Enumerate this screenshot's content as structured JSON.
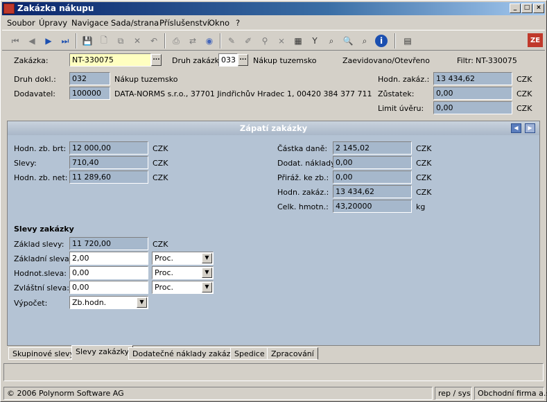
{
  "window": {
    "title": "Zakázka nákupu"
  },
  "menu": [
    {
      "label": "Soubor"
    },
    {
      "label": "Úpravy"
    },
    {
      "label": "Navigace"
    },
    {
      "label": "Sada/strana"
    },
    {
      "label": "Příslušenství"
    },
    {
      "label": "Okno"
    },
    {
      "label": "?"
    }
  ],
  "header": {
    "zakazka_label": "Zakázka:",
    "zakazka_value": "NT-330075",
    "druh_zakazky_label": "Druh zakázk:",
    "druh_zakazky_value": "033",
    "druh_zakazky_text": "Nákup tuzemsko",
    "status_text": "Zaevidovano/Otevřeno",
    "filtr_label": "Filtr:",
    "filtr_value": "NT-330075",
    "druh_dokl_label": "Druh dokl.:",
    "druh_dokl_value": "032",
    "druh_dokl_text": "Nákup tuzemsko",
    "dodavatel_label": "Dodavatel:",
    "dodavatel_value": "100000",
    "dodavatel_text": "DATA-NORMS s.r.o., 37701 Jindřichův Hradec 1, 00420 384 377 711",
    "hodn_zakaz_label": "Hodn. zakáz.:",
    "hodn_zakaz_value": "13 434,62",
    "hodn_zakaz_unit": "CZK",
    "zustatek_label": "Zůstatek:",
    "zustatek_value": "0,00",
    "zustatek_unit": "CZK",
    "limit_label": "Limit úvěru:",
    "limit_value": "0,00",
    "limit_unit": "CZK"
  },
  "panel": {
    "title": "Zápatí zakázky",
    "left": [
      {
        "label": "Hodn. zb. brt:",
        "value": "12 000,00",
        "unit": "CZK"
      },
      {
        "label": "Slevy:",
        "value": "710,40",
        "unit": "CZK"
      },
      {
        "label": "Hodn. zb. net:",
        "value": "11 289,60",
        "unit": "CZK"
      }
    ],
    "right": [
      {
        "label": "Částka daně:",
        "value": "2 145,02",
        "unit": "CZK"
      },
      {
        "label": "Dodat. náklady:",
        "value": "0,00",
        "unit": "CZK"
      },
      {
        "label": "Přiráž. ke zb.:",
        "value": "0,00",
        "unit": "CZK"
      },
      {
        "label": "Hodn. zakáz.:",
        "value": "13 434,62",
        "unit": "CZK"
      },
      {
        "label": "Celk. hmotn.:",
        "value": "43,20000",
        "unit": "kg"
      }
    ],
    "discounts_title": "Slevy zakázky",
    "zaklad_slevy_label": "Základ slevy:",
    "zaklad_slevy_value": "11 720,00",
    "zaklad_slevy_unit": "CZK",
    "zakladni_sleva_label": "Základní sleva:",
    "zakladni_sleva_value": "2,00",
    "zakladni_sleva_type": "Proc.",
    "hodnot_sleva_label": "Hodnot.sleva:",
    "hodnot_sleva_value": "0,00",
    "hodnot_sleva_type": "Proc.",
    "zvlastni_sleva_label": "Zvláštní sleva:",
    "zvlastni_sleva_value": "0,00",
    "zvlastni_sleva_type": "Proc.",
    "vypocet_label": "Výpočet:",
    "vypocet_value": "Zb.hodn."
  },
  "tabs": [
    {
      "label": "Skupinové slevy"
    },
    {
      "label": "Slevy zakázky"
    },
    {
      "label": "Dodatečné náklady zakázky"
    },
    {
      "label": "Spedice"
    },
    {
      "label": "Zpracování"
    }
  ],
  "status": {
    "copyright": "© 2006 Polynorm Software AG",
    "user": "rep / sys",
    "company": "Obchodní firma a.s."
  }
}
